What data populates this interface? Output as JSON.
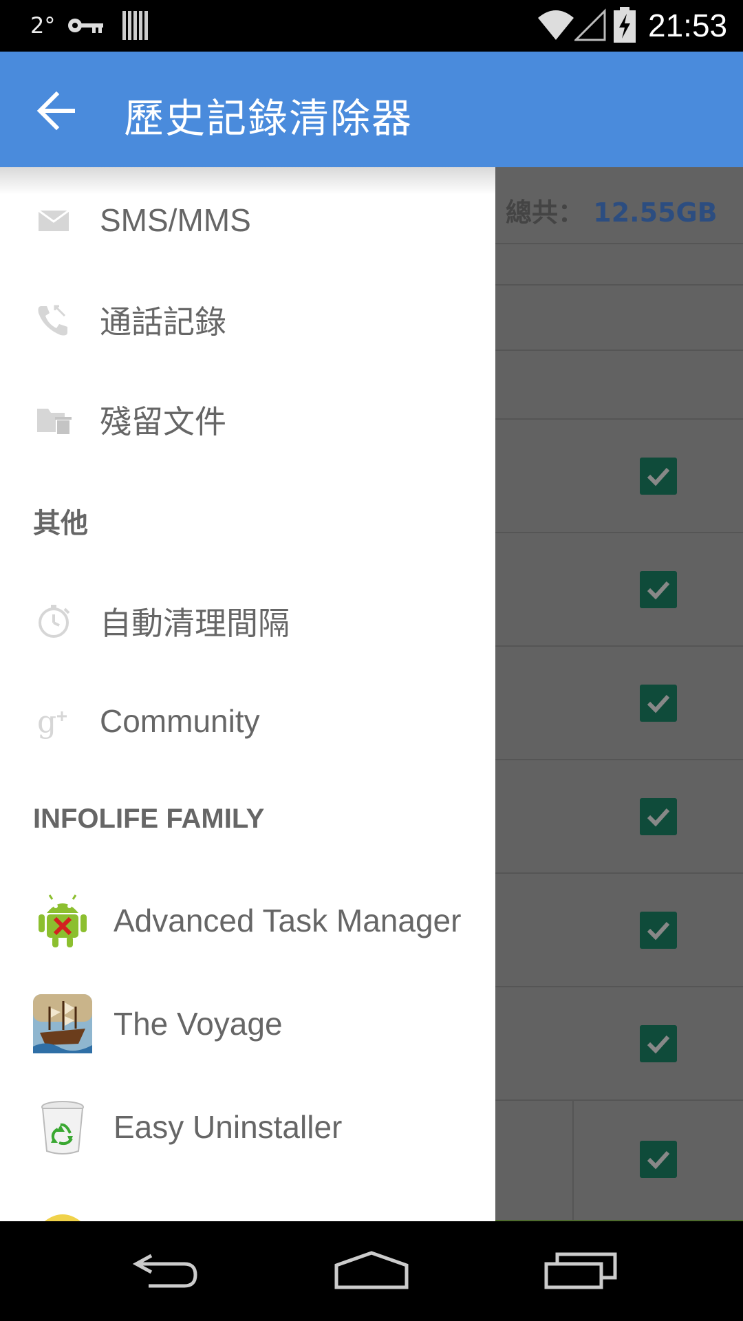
{
  "status_bar": {
    "temperature": "2°",
    "time": "21:53"
  },
  "app_bar": {
    "title": "歷史記錄清除器"
  },
  "background": {
    "total_label": "總共：",
    "total_value": "12.55GB"
  },
  "drawer": {
    "items": [
      {
        "label": "SMS/MMS",
        "icon": "mail-icon"
      },
      {
        "label": "通話記錄",
        "icon": "call-log-icon"
      },
      {
        "label": "殘留文件",
        "icon": "folder-trash-icon"
      }
    ],
    "section_other": "其他",
    "other_items": [
      {
        "label": "自動清理間隔",
        "icon": "timer-icon"
      },
      {
        "label": "Community",
        "icon": "google-plus-icon"
      }
    ],
    "section_family": "INFOLIFE FAMILY",
    "family_apps": [
      {
        "label": "Advanced Task Manager",
        "icon": "android-x-icon"
      },
      {
        "label": "The Voyage",
        "icon": "ship-icon"
      },
      {
        "label": "Easy Uninstaller",
        "icon": "recycle-bin-icon"
      }
    ]
  },
  "colors": {
    "app_bar": "#4a8bdc",
    "checkbox": "#0f4b3a"
  }
}
